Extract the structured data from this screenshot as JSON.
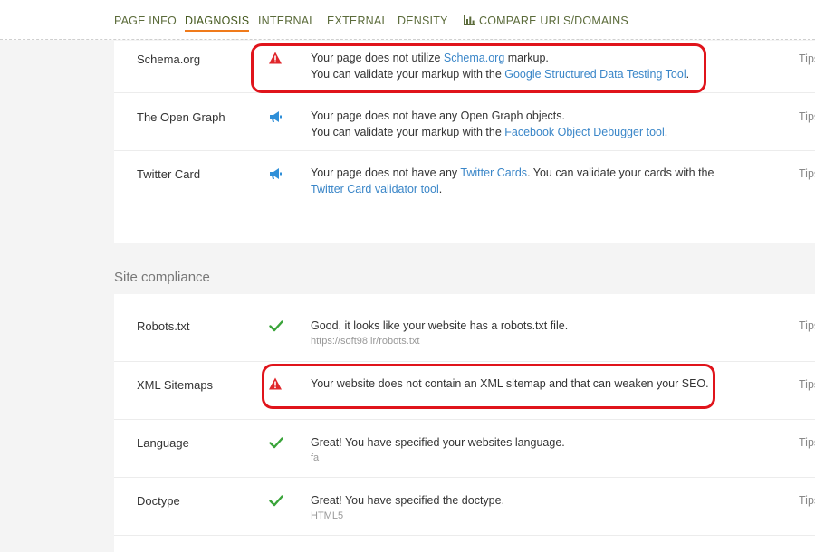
{
  "nav": {
    "items": [
      {
        "label": "PAGE INFO"
      },
      {
        "label": "DIAGNOSIS"
      },
      {
        "label": "INTERNAL"
      },
      {
        "label": "EXTERNAL"
      },
      {
        "label": "DENSITY"
      },
      {
        "label": "COMPARE URLS/DOMAINS",
        "icon": "bar-chart-icon"
      }
    ],
    "active": "DIAGNOSIS"
  },
  "social_card": {
    "rows": [
      {
        "label": "Schema.org",
        "status_icon": "warning-icon",
        "line1_a": "Your page does not utilize ",
        "line1_link": "Schema.org",
        "line1_b": " markup.",
        "line2_a": "You can validate your markup with the ",
        "line2_link": "Google Structured Data Testing Tool",
        "line2_b": ".",
        "tips": "Tips"
      },
      {
        "label": "The Open Graph",
        "status_icon": "megaphone-icon",
        "line1": "Your page does not have any Open Graph objects.",
        "line2_a": "You can validate your markup with the ",
        "line2_link": "Facebook Object Debugger tool",
        "line2_b": ".",
        "tips": "Tips"
      },
      {
        "label": "Twitter Card",
        "status_icon": "megaphone-icon",
        "text_a": "Your page does not have any ",
        "link_a": "Twitter Cards",
        "text_b": ". You can validate your cards with the ",
        "link_b": "Twitter Card validator tool",
        "text_c": ".",
        "tips": "Tips"
      }
    ]
  },
  "site_compliance": {
    "title": "Site compliance",
    "rows": [
      {
        "label": "Robots.txt",
        "status_icon": "check-icon",
        "text": "Good, it looks like your website has a robots.txt file.",
        "sub": "https://soft98.ir/robots.txt",
        "tips": "Tips"
      },
      {
        "label": "XML Sitemaps",
        "status_icon": "warning-icon",
        "text": "Your website does not contain an XML sitemap and that can weaken your SEO.",
        "tips": "Tips"
      },
      {
        "label": "Language",
        "status_icon": "check-icon",
        "text": "Great! You have specified your websites language.",
        "sub": "fa",
        "tips": "Tips"
      },
      {
        "label": "Doctype",
        "status_icon": "check-icon",
        "text": "Great! You have specified the doctype.",
        "sub": "HTML5",
        "tips": "Tips"
      }
    ]
  },
  "colors": {
    "accent_underline": "#f07b1b",
    "nav_text": "#5b6b3a",
    "link": "#3a86c8",
    "warning": "#e0262b",
    "success": "#3aa43a",
    "info": "#2f8fd8",
    "highlight_box": "#e0141b"
  }
}
